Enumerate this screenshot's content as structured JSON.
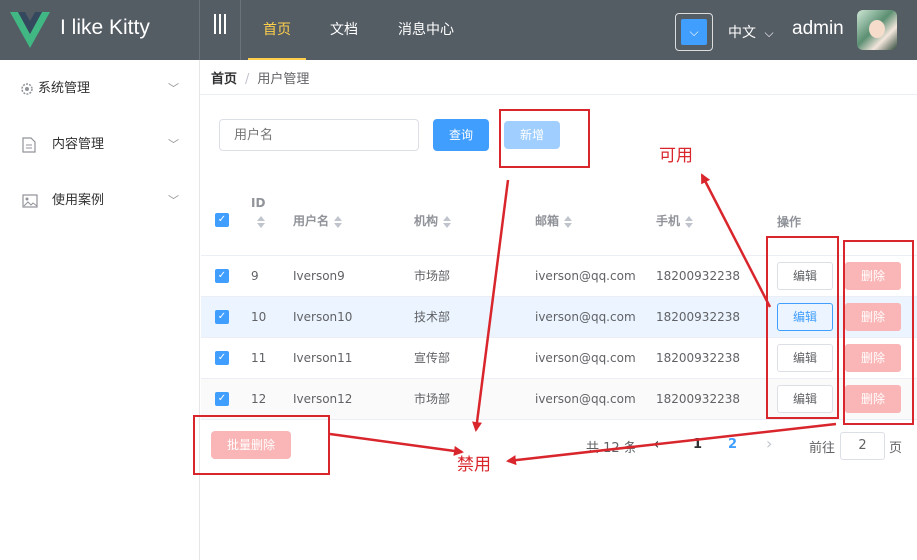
{
  "header": {
    "logo_text": "I like Kitty",
    "nav": [
      "首页",
      "文档",
      "消息中心"
    ],
    "theme_glyph": "⌵",
    "lang": "中文",
    "lang_caret": "⌵",
    "user": "admin"
  },
  "sidebar": {
    "items": [
      {
        "label": "系统管理",
        "icon": "gear-icon"
      },
      {
        "label": "内容管理",
        "icon": "document-icon"
      },
      {
        "label": "使用案例",
        "icon": "picture-icon"
      }
    ]
  },
  "breadcrumb": {
    "home": "首页",
    "separator": "/",
    "current": "用户管理"
  },
  "toolbar": {
    "search_placeholder": "用户名",
    "query_label": "查询",
    "add_label": "新增"
  },
  "table": {
    "headers": {
      "id": "ID",
      "name": "用户名",
      "org": "机构",
      "email": "邮箱",
      "phone": "手机",
      "ops": "操作"
    },
    "rows": [
      {
        "id": "9",
        "name": "Iverson9",
        "org": "市场部",
        "email": "iverson@qq.com",
        "phone": "18200932238"
      },
      {
        "id": "10",
        "name": "Iverson10",
        "org": "技术部",
        "email": "iverson@qq.com",
        "phone": "18200932238"
      },
      {
        "id": "11",
        "name": "Iverson11",
        "org": "宣传部",
        "email": "iverson@qq.com",
        "phone": "18200932238"
      },
      {
        "id": "12",
        "name": "Iverson12",
        "org": "市场部",
        "email": "iverson@qq.com",
        "phone": "18200932238"
      }
    ],
    "edit_label": "编辑",
    "delete_label": "删除"
  },
  "footer": {
    "batch_delete_label": "批量删除",
    "total": "共 12 条",
    "prev": "‹",
    "next": "›",
    "pages": [
      "1",
      "2"
    ],
    "goto_prefix": "前往",
    "goto_value": "2",
    "goto_suffix": "页"
  },
  "annotations": {
    "enabled": "可用",
    "disabled": "禁用"
  },
  "colors": {
    "primary": "#409eff",
    "header_bg": "#545c64",
    "active_nav": "#ffd04b",
    "annotation": "#d9252c",
    "danger_disabled": "#fab6b6"
  }
}
